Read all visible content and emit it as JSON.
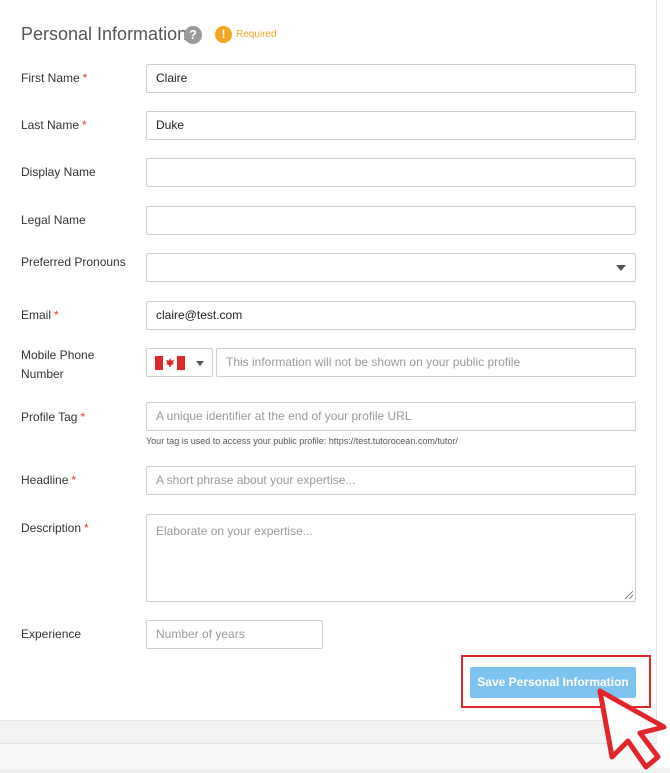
{
  "section": {
    "title": "Personal Information",
    "required_label": "Required",
    "help_glyph": "?",
    "required_glyph": "!"
  },
  "fields": {
    "first_name": {
      "label": "First Name",
      "value": "Claire",
      "required": "*"
    },
    "last_name": {
      "label": "Last Name",
      "value": "Duke",
      "required": "*"
    },
    "display_name": {
      "label": "Display Name",
      "value": ""
    },
    "legal_name": {
      "label": "Legal Name",
      "value": ""
    },
    "preferred_pronouns": {
      "label": "Preferred Pronouns",
      "value": ""
    },
    "email": {
      "label": "Email",
      "value": "claire@test.com",
      "required": "*"
    },
    "mobile_phone": {
      "label_line1": "Mobile Phone",
      "label_line2": "Number",
      "country": "canada-flag-icon",
      "placeholder": "This information will not be shown on your public profile"
    },
    "profile_tag": {
      "label": "Profile Tag",
      "required": "*",
      "placeholder": "A unique identifier at the end of your profile URL",
      "hint": "Your tag is used to access your public profile: https://test.tutorocean.com/tutor/"
    },
    "headline": {
      "label": "Headline",
      "required": "*",
      "placeholder": "A short phrase about your expertise..."
    },
    "description": {
      "label": "Description",
      "required": "*",
      "placeholder": "Elaborate on your expertise..."
    },
    "experience": {
      "label": "Experience",
      "placeholder": "Number of years"
    }
  },
  "actions": {
    "save_label": "Save Personal Information"
  },
  "colors": {
    "required_star": "#e53935",
    "required_badge": "#f5a623",
    "save_button": "#7ec3ef",
    "highlight": "#e2252b"
  }
}
